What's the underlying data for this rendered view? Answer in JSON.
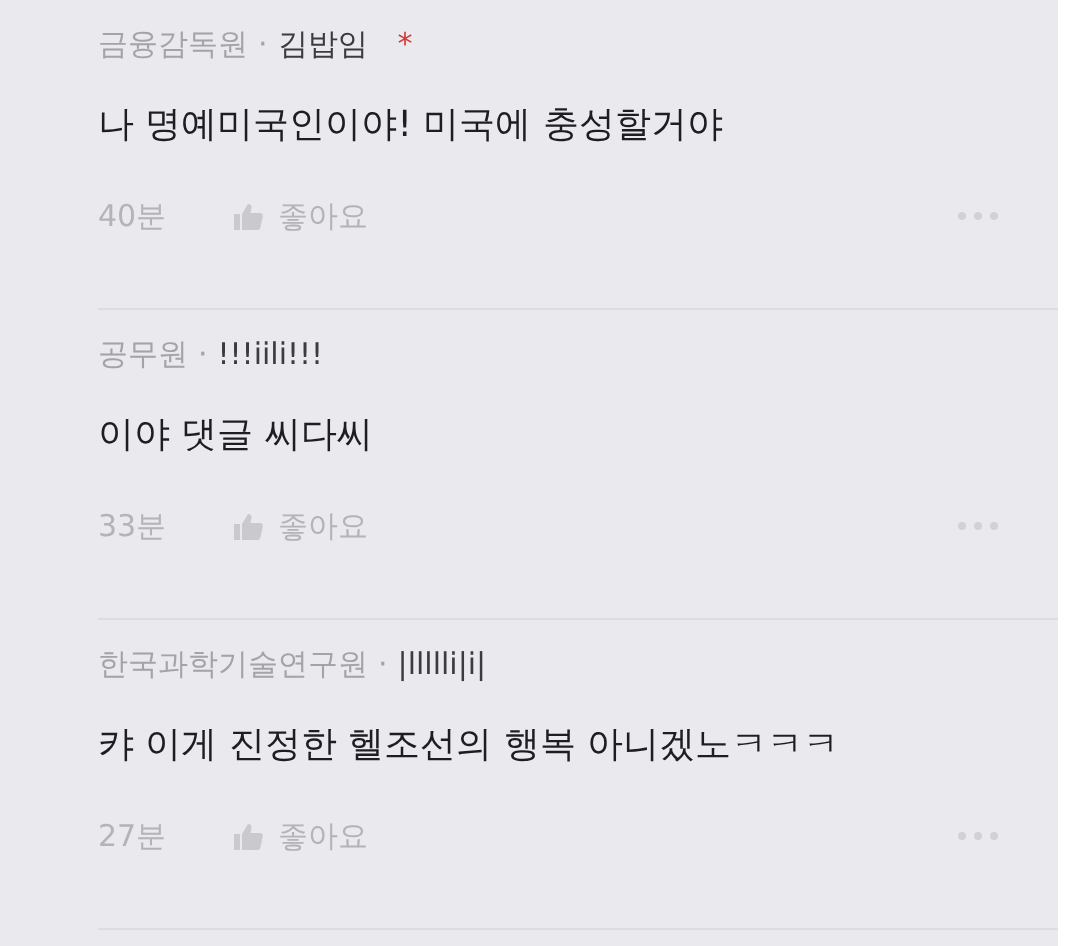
{
  "comments": [
    {
      "affiliation": "금융감독원",
      "separator": "·",
      "author": "김밥임",
      "mark": "*",
      "text": "나 명예미국인이야! 미국에 충성할거야",
      "time": "40분",
      "like": "좋아요"
    },
    {
      "affiliation": "공무원",
      "separator": "·",
      "author": "!!!iili!!!",
      "text": "이야 댓글 씨다씨",
      "time": "33분",
      "like": "좋아요"
    },
    {
      "affiliation": "한국과학기술연구원",
      "separator": "·",
      "author": "|llllli|i|",
      "text": "캬 이게 진정한 헬조선의 행복 아니겠노ㅋㅋㅋ",
      "time": "27분",
      "like": "좋아요"
    }
  ]
}
